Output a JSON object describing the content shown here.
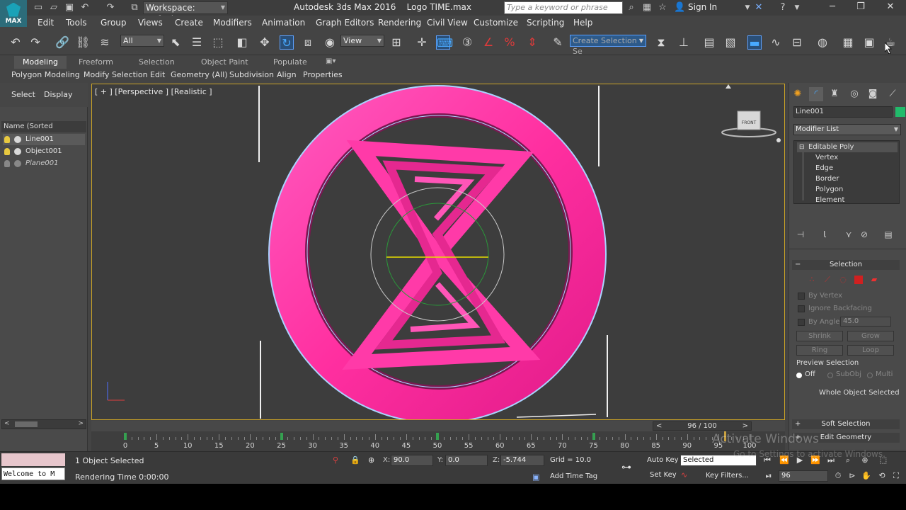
{
  "titlebar": {
    "logo_text": "MAX",
    "workspace": "Workspace: Default",
    "title": "Autodesk 3ds Max 2016    Logo TIME.max",
    "search_placeholder": "Type a keyword or phrase",
    "signin": "Sign In"
  },
  "menu": [
    "Edit",
    "Tools",
    "Group",
    "Views",
    "Create",
    "Modifiers",
    "Animation",
    "Graph Editors",
    "Rendering",
    "Civil View",
    "Customize",
    "Scripting",
    "Help"
  ],
  "toolbar": {
    "filter": "All",
    "refcoord": "View",
    "selection_set_placeholder": "Create Selection Se"
  },
  "ribbon": {
    "tabs": [
      "Modeling",
      "Freeform",
      "Selection",
      "Object Paint",
      "Populate"
    ],
    "row2": [
      "Polygon Modeling",
      "Modify Selection",
      "Edit",
      "Geometry (All)",
      "Subdivision",
      "Align",
      "Properties"
    ]
  },
  "scene_explorer": {
    "tabs": [
      "Select",
      "Display"
    ],
    "header": "Name (Sorted Ascending)",
    "rows": [
      "Line001",
      "Object001",
      "Plane001"
    ]
  },
  "viewport": {
    "label": "[ + ] [Perspective ] [Realistic ]",
    "viewcube": "FRONT"
  },
  "command_panel": {
    "object_name": "Line001",
    "object_color": "#21bb6b",
    "modifier_list": "Modifier List",
    "stack_parent": "Editable Poly",
    "stack_children": [
      "Vertex",
      "Edge",
      "Border",
      "Polygon",
      "Element"
    ],
    "selection_title": "Selection",
    "by_vertex": "By Vertex",
    "ignore_backfacing": "Ignore Backfacing",
    "by_angle": "By Angle:",
    "by_angle_value": "45.0",
    "shrink": "Shrink",
    "grow": "Grow",
    "ring": "Ring",
    "loop": "Loop",
    "preview_selection": "Preview Selection",
    "preview_off": "Off",
    "preview_subobj": "SubObj",
    "preview_multi": "Multi",
    "whole_object": "Whole Object Selected",
    "soft_selection": "Soft Selection",
    "edit_geometry": "Edit Geometry"
  },
  "timeline": {
    "frame_display": "96 / 100",
    "ticks": [
      0,
      5,
      10,
      15,
      20,
      25,
      30,
      35,
      40,
      45,
      50,
      55,
      60,
      65,
      70,
      75,
      80,
      85,
      90,
      95,
      100
    ],
    "keys": [
      0,
      25,
      50,
      75
    ],
    "current_frame": 96
  },
  "status": {
    "maxscript_text": "Welcome to M",
    "objects_selected": "1 Object Selected",
    "rendering_time": "Rendering Time  0:00:00",
    "x_label": "X:",
    "x": "90.0",
    "y_label": "Y:",
    "y": "0.0",
    "z_label": "Z:",
    "z": "-5.744",
    "grid": "Grid = 10.0",
    "add_time_tag": "Add Time Tag",
    "auto_key": "Auto Key",
    "set_key": "Set Key",
    "key_mode": "Selected",
    "key_filters": "Key Filters...",
    "frame": "96"
  },
  "watermark": {
    "line1": "Activate Windows",
    "line2": "Go to Settings to activate Windows."
  },
  "colors": {
    "logo_pink": "#ff3aa8",
    "viewport_border": "#c9a227",
    "accent_blue": "#48a9ff"
  }
}
